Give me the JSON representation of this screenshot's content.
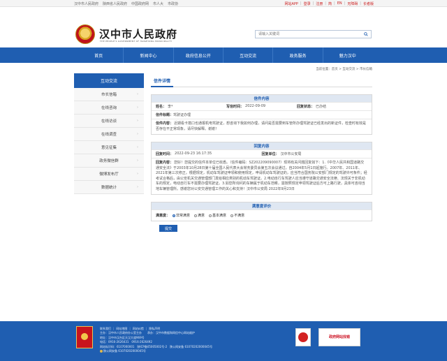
{
  "topbar": {
    "left_links": [
      "汉中市人民政府",
      "陕西省人民政府",
      "中国政府网",
      "市人大",
      "市政协"
    ],
    "right_links": [
      "网站APP",
      "登录",
      "注册",
      "简",
      "EN",
      "无障碍",
      "长者版"
    ]
  },
  "header": {
    "title": "汉中市人民政府",
    "subtitle": "THE PEOPLE'S GOVERNMENT OF HANZHONG MUNICIPALITY",
    "search_placeholder": "请输入关键词"
  },
  "nav": [
    "首页",
    "新闻中心",
    "政府信息公开",
    "互动交流",
    "政务服务",
    "魅力汉中"
  ],
  "breadcrumb": "当前位置：首页 > 互动交流 > 市长信箱",
  "sidebar": {
    "title": "互动交流",
    "items": [
      "市长信箱",
      "在线咨询",
      "在线访谈",
      "在线调查",
      "意见征集",
      "政务微信群",
      "微博发布厅",
      "数据统计"
    ]
  },
  "main": {
    "tab": "信件详情",
    "letter": {
      "title": "信件内容",
      "from_label": "姓名：",
      "from_value": "李*",
      "date_label": "写信时间：",
      "date_value": "2022-09-09",
      "status_label": "回复状态：",
      "status_value": "已办结",
      "subject_label": "信件标题：",
      "subject_value": "驾驶证办理",
      "content_label": "信件内容：",
      "content_value": "近期看卡搭口也通报机电驾驶证，想咨询下我如何办理，请问是否需要到车管所办理驾驶证已经发出的新证件，检查时有效是否存在不正常现象，请尽快解释。谢谢！"
    },
    "reply": {
      "title": "回复内容",
      "time_label": "回复时间：",
      "time_value": "2022-09-23 16:17:35",
      "dept_label": "回复单位：",
      "dept_value": "汉中市公安局",
      "content_label": "回复内容：",
      "content_value": "您好！您提交的信件本单位已收悉。（信件编码：SZ202209090007）现将有关问题回复如下：1.《中华人民共和国道路交通安全法》于2003年10月28日第十届全国人民代表大会常务委员会第五次会议通过，自2004年5月1日起施行。2007年、2011年、2021年第三次修正。根据规定，机动车驾驶证申领和使用规定，申请机动车驾驶证的，应当符合国务院公安部门规定的驾驶许可条件；经考试合格后，由公安机关交通管理部门发给相应类别的机动车驾驶证。2.电动自行车驾驶人应当遵守道路交通安全法律、法规关于非机动车的规定，电动自行车不需要办理驾驶证。3.如您所询问的车辆属于机动车范畴，需按照规定申领驾驶证后方可上路行驶，具体可咨询当地车辆管理所。感谢您对公安交通管理工作的关心和支持！汉中市公安局 2022年9月23日"
    },
    "survey": {
      "title": "满意度评价",
      "label": "满意度：",
      "options": [
        "非常满意",
        "满意",
        "基本满意",
        "不满意"
      ],
      "selected": "非常满意",
      "submit": "提交"
    }
  },
  "footer": {
    "links": [
      "联系我们",
      "网站地图",
      "网站纠错",
      "隐私声明"
    ],
    "host": "主办：汉中市人民政府办公室主办　　承办：汉中市数据和网信中心网站维护",
    "address": "地址：汉中市汉台区天汉大道969号",
    "phone": "电话：0916-2626431　0916-2626492",
    "icp": "网站标识码：6107000001　陕ICP备05005002号-2　陕公网安备 61070202000045号",
    "police": "陕公网安备 61070202000045号",
    "badge2": "政府网站找错"
  }
}
